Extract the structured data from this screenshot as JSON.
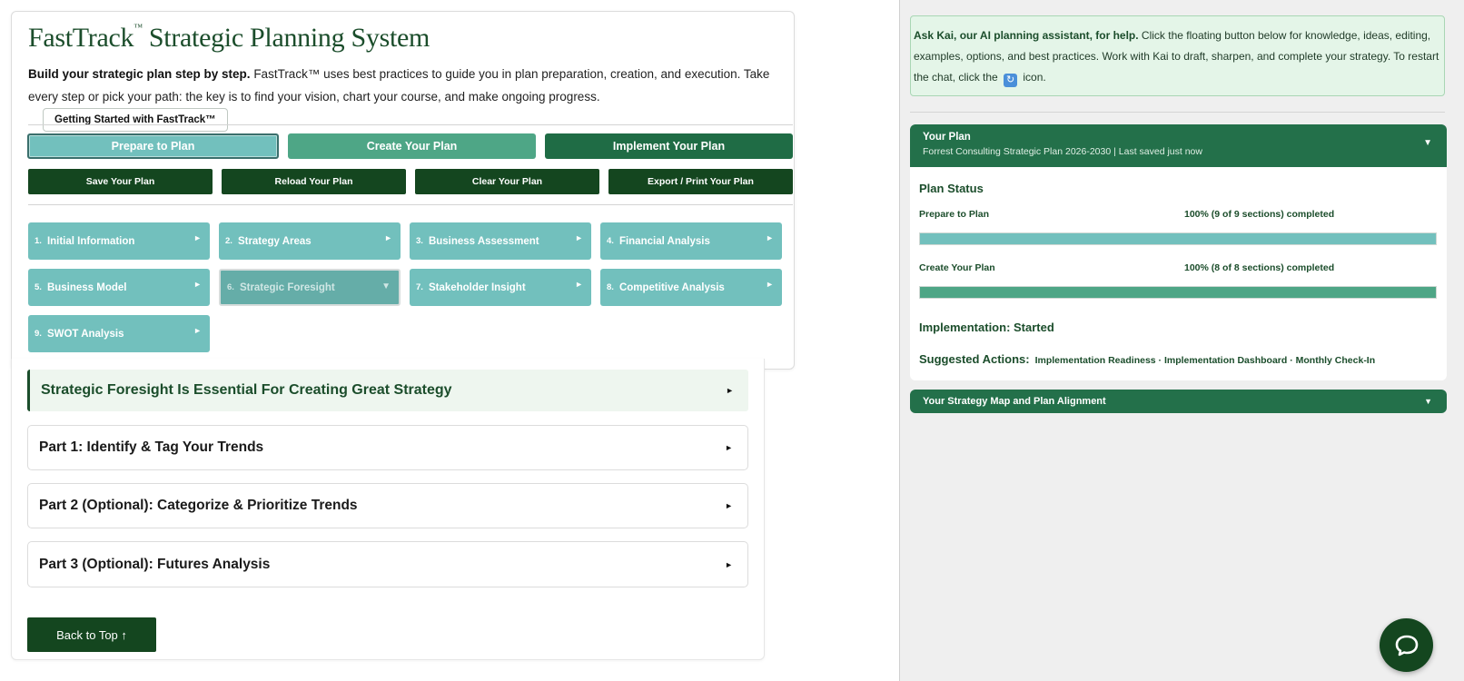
{
  "header": {
    "title": "FastTrack",
    "title_mark": "™",
    "title_rest": " Strategic Planning System",
    "intro_bold": "Build your strategic plan step by step.",
    "intro_text": " FastTrack™ uses best practices to guide you in plan preparation, creation, and execution. Take every step or pick your path: the key is to find your vision, chart your course, and make ongoing progress.",
    "getting_started_label": "Getting Started with FastTrack™"
  },
  "phases": [
    {
      "label": "Prepare to Plan",
      "active": true
    },
    {
      "label": "Create Your Plan",
      "active": false
    },
    {
      "label": "Implement Your Plan",
      "active": false
    }
  ],
  "actions": [
    {
      "label": "Save Your Plan"
    },
    {
      "label": "Reload Your Plan"
    },
    {
      "label": "Clear Your Plan"
    },
    {
      "label": "Export / Print Your Plan"
    }
  ],
  "steps": [
    {
      "num": "1.",
      "label": "Initial Information",
      "arrow": "►"
    },
    {
      "num": "2.",
      "label": "Strategy Areas",
      "arrow": "►"
    },
    {
      "num": "3.",
      "label": "Business Assessment",
      "arrow": "►"
    },
    {
      "num": "4.",
      "label": "Financial Analysis",
      "arrow": "►"
    },
    {
      "num": "5.",
      "label": "Business Model",
      "arrow": "►"
    },
    {
      "num": "6.",
      "label": "Strategic Foresight",
      "arrow": "▼"
    },
    {
      "num": "7.",
      "label": "Stakeholder Insight",
      "arrow": "►"
    },
    {
      "num": "8.",
      "label": "Competitive Analysis",
      "arrow": "►"
    },
    {
      "num": "9.",
      "label": "SWOT Analysis",
      "arrow": "►"
    }
  ],
  "sections": {
    "intro": "Strategic Foresight Is Essential For Creating Great Strategy",
    "part1": "Part 1: Identify & Tag Your Trends",
    "part2": "Part 2 (Optional): Categorize & Prioritize Trends",
    "part3": "Part 3 (Optional): Futures Analysis",
    "arrow": "►",
    "back_to_top": "Back to Top ↑"
  },
  "sidebar": {
    "help_bold": "Ask Kai, our AI planning assistant, for help.",
    "help_text": " Click the floating button below for knowledge, ideas, editing, examples, options, and best practices. Work with Kai to draft, sharpen, and complete your strategy. To restart the chat, click the ",
    "help_icon": "refresh-icon",
    "help_icon_glyph": "↻",
    "help_end": " icon.",
    "plan": {
      "title": "Your Plan",
      "subtitle": "Forrest Consulting Strategic Plan 2026-2030 | Last saved just now",
      "toggle": "▼",
      "status_title": "Plan Status",
      "prepare_label": "Prepare to Plan",
      "prepare_value": "100% (9 of 9 sections) completed",
      "prepare_progress": 1.0,
      "create_label": "Create Your Plan",
      "create_value": "100% (8 of 8 sections) completed",
      "create_progress": 1.0,
      "implementation": "Implementation: Started",
      "suggested_label": "Suggested Actions:",
      "suggested_actions": "Implementation Readiness · Implementation Dashboard · Monthly Check-In"
    },
    "map_title": "Your Strategy Map and Plan Alignment",
    "map_toggle": "▼"
  },
  "colors": {
    "brand_dark": "#14461f",
    "brand_green": "#23704a",
    "teal": "#72c0bd",
    "mid_green": "#4ea686"
  },
  "chat_button_icon": "chat-bubble-icon"
}
